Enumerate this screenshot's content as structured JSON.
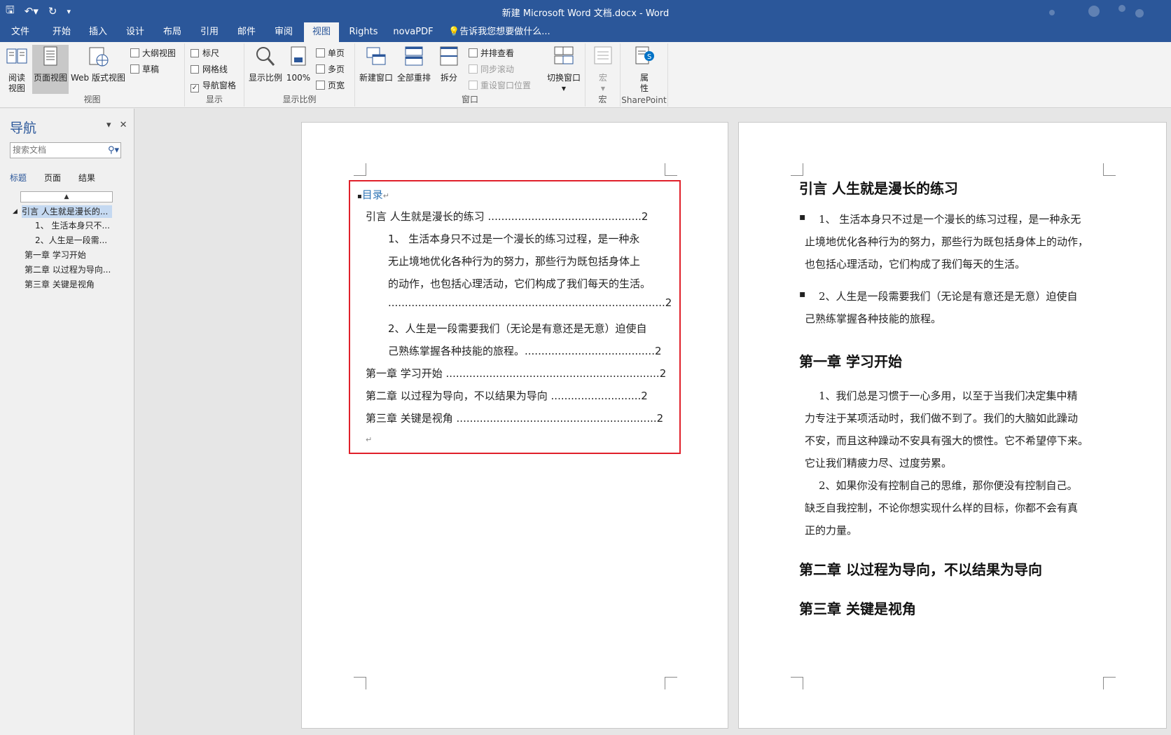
{
  "window": {
    "title": "新建 Microsoft Word 文档.docx - Word",
    "qat": {
      "save_icon": "save-icon",
      "undo_icon": "undo-icon",
      "redo_icon": "redo-icon",
      "customize_icon": "customize-icon"
    }
  },
  "tabs": [
    "文件",
    "开始",
    "插入",
    "设计",
    "布局",
    "引用",
    "邮件",
    "审阅",
    "视图",
    "Rights",
    "novaPDF",
    "告诉我您想要做什么..."
  ],
  "active_tab": "视图",
  "ribbon": {
    "views": {
      "label": "视图",
      "read_mode": [
        "阅读",
        "视图"
      ],
      "print_layout": "页面视图",
      "web_layout": "Web 版式视图",
      "outline": "大纲视图",
      "draft": "草稿"
    },
    "show": {
      "label": "显示",
      "ruler": "标尺",
      "gridlines": "网格线",
      "nav_pane": "导航窗格",
      "ruler_checked": false,
      "gridlines_checked": false,
      "nav_pane_checked": true
    },
    "zoom": {
      "label": "显示比例",
      "zoom": "显示比例",
      "hundred": "100%",
      "one_page": "单页",
      "multiple_pages": "多页",
      "page_width": "页宽"
    },
    "window": {
      "label": "窗口",
      "new_window": "新建窗口",
      "arrange_all": "全部重排",
      "split": "拆分",
      "side_by_side": "并排查看",
      "sync_scroll": "同步滚动",
      "reset_position": "重设窗口位置",
      "switch_windows": "切换窗口"
    },
    "macros": {
      "label": "宏",
      "macros": "宏"
    },
    "sharepoint": {
      "label": "SharePoint",
      "properties": [
        "属",
        "性"
      ]
    }
  },
  "nav_pane": {
    "title": "导航",
    "search_placeholder": "搜索文档",
    "tabs": [
      "标题",
      "页面",
      "结果"
    ],
    "active_tab": "标题",
    "items": [
      {
        "label": "引言 人生就是漫长的...",
        "level": 1,
        "selected": true,
        "expanded": true
      },
      {
        "label": "1、 生活本身只不...",
        "level": 2
      },
      {
        "label": "2、人生是一段需...",
        "level": 2
      },
      {
        "label": "第一章 学习开始",
        "level": 1
      },
      {
        "label": "第二章 以过程为导向...",
        "level": 1
      },
      {
        "label": "第三章 关键是视角",
        "level": 1
      }
    ]
  },
  "page1": {
    "toc_title": "目录",
    "lines": [
      "引言  人生就是漫长的练习 ..............................................2",
      "1、  生活本身只不过是一个漫长的练习过程，是一种永",
      "无止境地优化各种行为的努力，那些行为既包括身体上",
      "的动作，也包括心理活动，它们构成了我们每天的生活。",
      "...................................................................................2",
      "2、人生是一段需要我们（无论是有意还是无意）迫使自",
      "己熟练掌握各种技能的旅程。.......................................2",
      "第一章  学习开始 ................................................................2",
      "第二章  以过程为导向，不以结果为导向 ...........................2",
      "第三章  关键是视角 ............................................................2"
    ]
  },
  "page2": {
    "heading_intro": "引言  人生就是漫长的练习",
    "p1": [
      "1、 生活本身只不过是一个漫长的练习过程，是一种永无",
      "止境地优化各种行为的努力，那些行为既包括身体上的动作，",
      "也包括心理活动，它们构成了我们每天的生活。"
    ],
    "p2": [
      "2、人生是一段需要我们（无论是有意还是无意）迫使自",
      "己熟练掌握各种技能的旅程。"
    ],
    "heading_ch1": "第一章  学习开始",
    "ch1_lines": [
      "1、我们总是习惯于一心多用，以至于当我们决定集中精",
      "力专注于某项活动时，我们做不到了。我们的大脑如此躁动",
      "不安，而且这种躁动不安具有强大的惯性。它不希望停下来。",
      "它让我们精疲力尽、过度劳累。",
      "2、如果你没有控制自己的思维，那你便没有控制自己。",
      "缺乏自我控制，不论你想实现什么样的目标，你都不会有真",
      "正的力量。"
    ],
    "heading_ch2": "第二章  以过程为导向，不以结果为导向",
    "heading_ch3": "第三章  关键是视角"
  }
}
